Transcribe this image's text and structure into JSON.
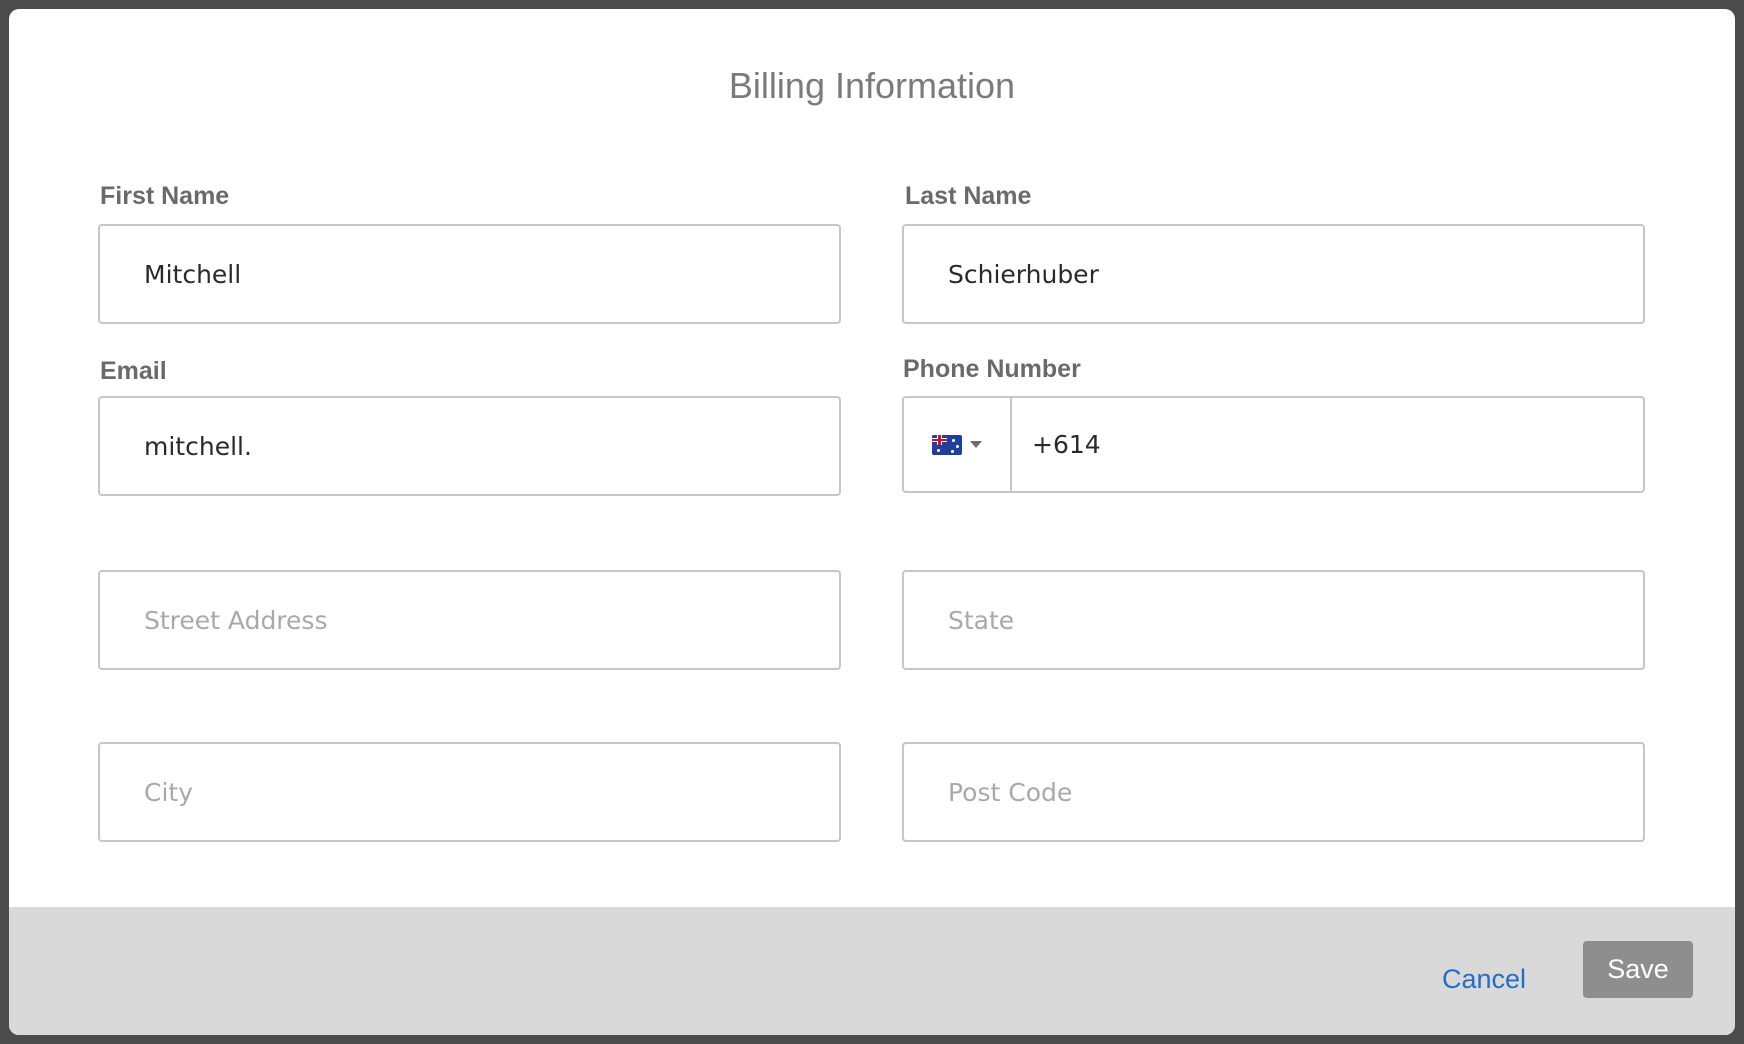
{
  "dialog": {
    "title": "Billing Information"
  },
  "form": {
    "first_name": {
      "label": "First Name",
      "value": "Mitchell",
      "placeholder": ""
    },
    "last_name": {
      "label": "Last Name",
      "value": "Schierhuber",
      "placeholder": ""
    },
    "email": {
      "label": "Email",
      "value": "mitchell.",
      "placeholder": ""
    },
    "phone": {
      "label": "Phone Number",
      "value": "+614",
      "country_icon": "australia-flag-icon"
    },
    "street_address": {
      "value": "",
      "placeholder": "Street Address"
    },
    "state": {
      "value": "",
      "placeholder": "State"
    },
    "city": {
      "value": "",
      "placeholder": "City"
    },
    "post_code": {
      "value": "",
      "placeholder": "Post Code"
    }
  },
  "footer": {
    "cancel_label": "Cancel",
    "save_label": "Save"
  },
  "colors": {
    "link": "#1f6fc5",
    "save_button_bg": "#8e8e8e",
    "footer_bg": "#d9d9d9",
    "overlay_bg": "#4b4b4b"
  }
}
